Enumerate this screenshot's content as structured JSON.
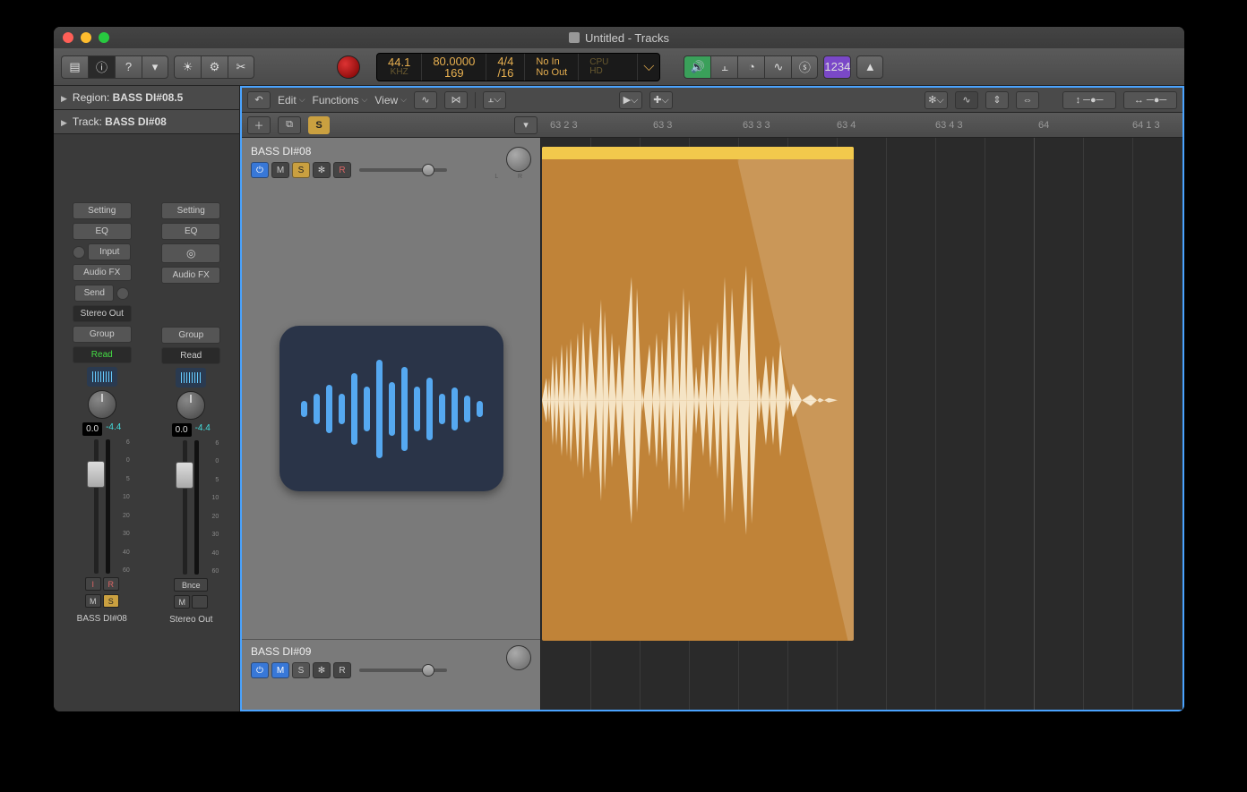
{
  "window": {
    "title": "Untitled - Tracks"
  },
  "traffic": {
    "close": "#ff5f57",
    "min": "#ffbd2e",
    "max": "#28c940"
  },
  "lcd": {
    "sample_rate": "44.1",
    "sample_rate_label": "KHZ",
    "tempo": "80.0000",
    "bar": "169",
    "sig_top": "4/4",
    "sig_bot": "/16",
    "in": "No In",
    "out": "No Out",
    "cpu": "CPU",
    "hd": "HD"
  },
  "toolbar_right": {
    "count": "1234"
  },
  "inspector": {
    "region": "BASS DI#08.5",
    "track": "BASS DI#08",
    "slots": {
      "setting": "Setting",
      "eq": "EQ",
      "input": "Input",
      "audiofx": "Audio FX",
      "send": "Send",
      "stereoout": "Stereo Out",
      "group": "Group",
      "read": "Read"
    },
    "pan": {
      "val": "0.0",
      "db": "-4.4"
    },
    "bnce": "Bnce",
    "labels": {
      "left": "BASS DI#08",
      "right": "Stereo Out"
    }
  },
  "editor": {
    "menus": {
      "edit": "Edit",
      "functions": "Functions",
      "view": "View"
    },
    "solo": "S",
    "ruler": [
      "63 2 3",
      "63 3",
      "63 3 3",
      "63 4",
      "63 4 3",
      "64",
      "64 1 3"
    ],
    "track1": {
      "name": "BASS DI#08",
      "buttons": {
        "m": "M",
        "s": "S",
        "fz": "✻",
        "r": "R"
      }
    },
    "track2": {
      "name": "BASS DI#09",
      "buttons": {
        "m": "M",
        "s": "S",
        "fz": "✻",
        "r": "R"
      }
    }
  },
  "mixer": {
    "m": "M",
    "s": "S",
    "i": "I",
    "r": "R"
  },
  "waveicon_heights": [
    18,
    34,
    54,
    34,
    80,
    50,
    110,
    60,
    94,
    50,
    70,
    34,
    48,
    30,
    18
  ]
}
